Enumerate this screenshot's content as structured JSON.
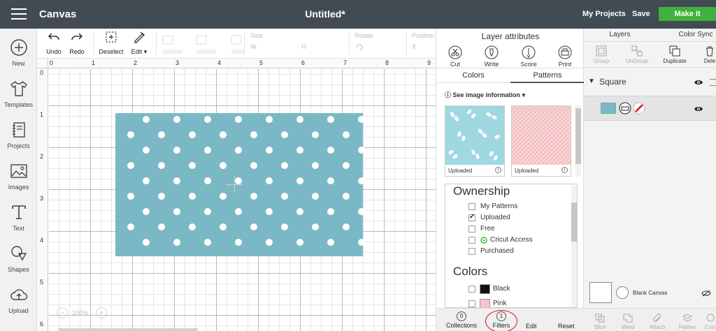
{
  "topbar": {
    "app_title": "Canvas",
    "doc_title": "Untitled*",
    "my_projects": "My Projects",
    "save": "Save",
    "make_it": "Make It",
    "accent": "#3fb13d"
  },
  "leftnav": {
    "items": [
      {
        "label": "New",
        "icon": "plus-circle-icon"
      },
      {
        "label": "Templates",
        "icon": "shirt-icon"
      },
      {
        "label": "Projects",
        "icon": "notebook-icon"
      },
      {
        "label": "Images",
        "icon": "image-icon"
      },
      {
        "label": "Text",
        "icon": "text-T-icon"
      },
      {
        "label": "Shapes",
        "icon": "shapes-icon"
      },
      {
        "label": "Upload",
        "icon": "cloud-upload-icon"
      }
    ]
  },
  "toolbar": {
    "undo": "Undo",
    "redo": "Redo",
    "deselect": "Deselect",
    "edit": "Edit",
    "size_label": "Size",
    "w": "W",
    "h": "H",
    "rotate_label": "Rotate",
    "position_label": "Position",
    "x": "X"
  },
  "canvas": {
    "ruler_x": [
      "0",
      "1",
      "2",
      "3",
      "4",
      "5",
      "6",
      "7",
      "8",
      "9"
    ],
    "ruler_y": [
      "0",
      "1",
      "2",
      "3",
      "4",
      "5",
      "6"
    ],
    "square_color": "#7bb8c5",
    "zoom": "100%"
  },
  "attributes": {
    "title": "Layer attributes",
    "tools": [
      "Cut",
      "Write",
      "Score",
      "Print"
    ],
    "tabs": [
      "Colors",
      "Patterns"
    ],
    "see_info": "See image information",
    "patterns": [
      {
        "caption": "Uploaded",
        "color": "#9fd8df"
      },
      {
        "caption": "Uploaded",
        "color": "#f8d8d8"
      }
    ],
    "ownership_heading": "Ownership",
    "ownership": [
      {
        "label": "My Patterns",
        "checked": false
      },
      {
        "label": "Uploaded",
        "checked": true
      },
      {
        "label": "Free",
        "checked": false
      },
      {
        "label": "Cricut Access",
        "checked": false
      },
      {
        "label": "Purchased",
        "checked": false
      }
    ],
    "colors_heading": "Colors",
    "colors": [
      {
        "label": "Black",
        "swatch": "#111111"
      },
      {
        "label": "Pink",
        "swatch": "#f6c3cf"
      }
    ],
    "bottom": {
      "collections_count": "0",
      "collections": "Collections",
      "filters_count": "1",
      "filters": "Filters",
      "edit": "Edit",
      "reset": "Reset"
    }
  },
  "layers": {
    "tabs": [
      "Layers",
      "Color Sync"
    ],
    "tools": [
      "Group",
      "UnGroup",
      "Duplicate",
      "Dele"
    ],
    "group_name": "Square",
    "blank_canvas": "Blank Canvas",
    "bottom_tools": [
      "Slice",
      "Weld",
      "Attach",
      "Flatten",
      "Con"
    ]
  }
}
